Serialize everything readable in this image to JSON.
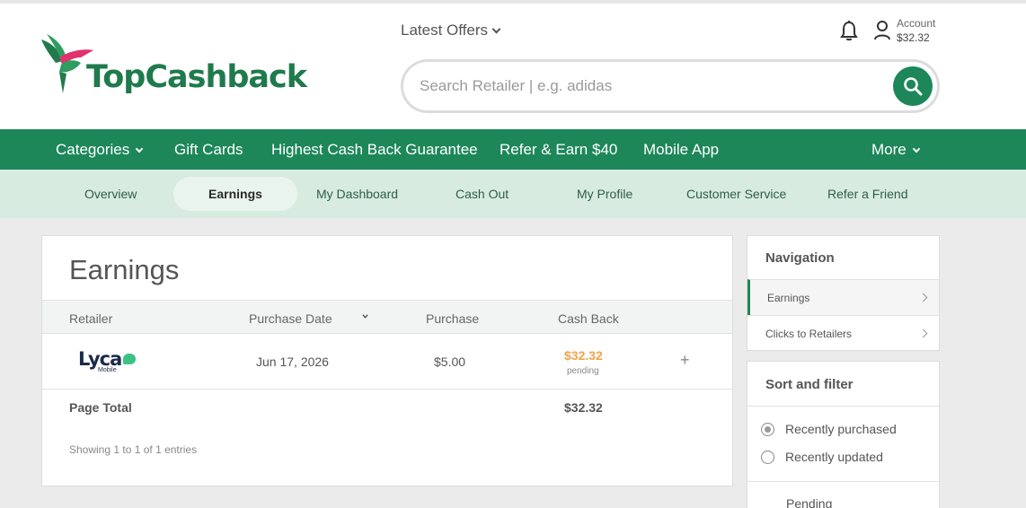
{
  "brand": {
    "name": "TopCashback",
    "accent": "#1d8759",
    "cashback_color": "#f5a14a"
  },
  "header": {
    "latest_offers": "Latest Offers",
    "search_placeholder": "Search Retailer | e.g. adidas",
    "account_label": "Account",
    "account_balance": "$32.32",
    "icons": [
      "bell-icon",
      "user-icon",
      "search-icon"
    ]
  },
  "main_nav": {
    "categories": "Categories",
    "gift_cards": "Gift Cards",
    "guarantee": "Highest Cash Back Guarantee",
    "refer": "Refer & Earn $40",
    "mobile_app": "Mobile App",
    "more": "More"
  },
  "sub_nav": {
    "overview": "Overview",
    "earnings": "Earnings",
    "dashboard": "My Dashboard",
    "cash_out": "Cash Out",
    "profile": "My Profile",
    "service": "Customer Service",
    "refer_friend": "Refer a Friend"
  },
  "earnings": {
    "title": "Earnings",
    "columns": {
      "retailer": "Retailer",
      "purchase_date": "Purchase Date",
      "purchase": "Purchase",
      "cash_back": "Cash Back"
    },
    "rows": [
      {
        "retailer_logo": "Lyca",
        "retailer_logo_sub": "Mobile",
        "purchase_date": "Jun 17, 2026",
        "purchase": "$5.00",
        "cash_back": "$32.32",
        "status": "pending"
      }
    ],
    "page_total_label": "Page Total",
    "page_total_value": "$32.32",
    "showing": "Showing 1 to 1 of 1 entries"
  },
  "side_nav": {
    "title": "Navigation",
    "items": [
      {
        "label": "Earnings",
        "active": true
      },
      {
        "label": "Clicks to Retailers",
        "active": false
      }
    ]
  },
  "sort_filter": {
    "title": "Sort and filter",
    "options": [
      {
        "label": "Recently purchased",
        "selected": true
      },
      {
        "label": "Recently updated",
        "selected": false
      }
    ],
    "pending_label": "Pending"
  }
}
